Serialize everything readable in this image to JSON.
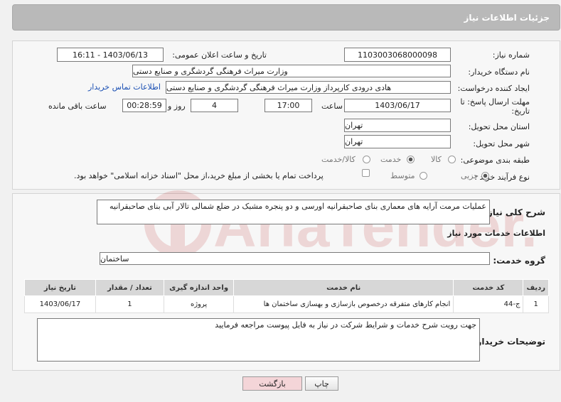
{
  "header": {
    "title": "جزئیات اطلاعات نیاز"
  },
  "form": {
    "need_number_label": "شماره نیاز:",
    "need_number": "1103003068000098",
    "announce_label": "تاریخ و ساعت اعلان عمومی:",
    "announce_value": "1403/06/13 - 16:11",
    "buyer_org_label": "نام دستگاه خریدار:",
    "buyer_org": "وزارت میراث فرهنگی  گردشگری و صنایع دستی",
    "creator_label": "ایجاد کننده درخواست:",
    "creator": "هادی درودی کارپرداز وزارت میراث فرهنگی  گردشگری و صنایع دستی",
    "contact_link": "اطلاعات تماس خریدار",
    "deadline_label_1": "مهلت ارسال پاسخ: تا",
    "deadline_label_2": "تاریخ:",
    "deadline_date": "1403/06/17",
    "time_label": "ساعت",
    "deadline_time": "17:00",
    "days_value": "4",
    "days_label": "روز و",
    "remaining_time": "00:28:59",
    "remaining_label": "ساعت باقی مانده",
    "province_label": "استان محل تحویل:",
    "province": "تهران",
    "city_label": "شهر محل تحویل:",
    "city": "تهران",
    "category_label": "طبقه بندی موضوعی:",
    "category_options": [
      "کالا",
      "خدمت",
      "کالا/خدمت"
    ],
    "category_selected": "خدمت",
    "process_label": "نوع فرآیند خرید :",
    "process_options": [
      "جزیی",
      "متوسط"
    ],
    "process_selected": "جزیی",
    "payment_note": "پرداخت تمام یا بخشی از مبلغ خرید،از محل \"اسناد خزانه اسلامی\" خواهد بود."
  },
  "details": {
    "summary_label": "شرح کلی نیاز:",
    "summary": "عملیات مرمت آرایه های معماری بنای صاحبقرانیه  اورسی و دو پنجره مشبک در ضلع شمالی تالار آبی بنای صاحبقرانیه",
    "services_title": "اطلاعات خدمات مورد نیاز",
    "group_label": "گروه خدمت:",
    "group_value": "ساختمان",
    "table": {
      "headers": [
        "ردیف",
        "کد خدمت",
        "نام خدمت",
        "واحد اندازه گیری",
        "تعداد / مقدار",
        "تاریخ نیاز"
      ],
      "rows": [
        [
          "1",
          "ج-44",
          "انجام کارهای متفرقه درخصوص بازسازی و بهسازی ساختمان ها",
          "پروژه",
          "1",
          "1403/06/17"
        ]
      ]
    },
    "buyer_notes_label": "توضیحات خریدار:",
    "buyer_notes": "جهت رویت شرح خدمات و  شرایط شرکت در نیاز به فایل پیوست مراجعه فرمایید"
  },
  "buttons": {
    "print": "چاپ",
    "back": "بازگشت"
  },
  "watermark": {
    "text": "AriaTender.neT"
  }
}
